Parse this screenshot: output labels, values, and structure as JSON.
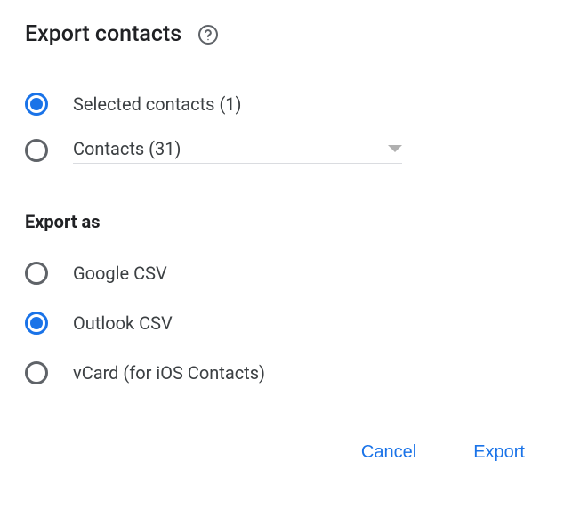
{
  "dialog": {
    "title": "Export contacts"
  },
  "scope": {
    "options": [
      {
        "label": "Selected contacts (1)",
        "selected": true
      },
      {
        "label": "Contacts (31)",
        "selected": false,
        "dropdown": true
      }
    ]
  },
  "export_as": {
    "label": "Export as",
    "options": [
      {
        "label": "Google CSV",
        "selected": false
      },
      {
        "label": "Outlook CSV",
        "selected": true
      },
      {
        "label": "vCard (for iOS Contacts)",
        "selected": false
      }
    ]
  },
  "actions": {
    "cancel": "Cancel",
    "export": "Export"
  }
}
